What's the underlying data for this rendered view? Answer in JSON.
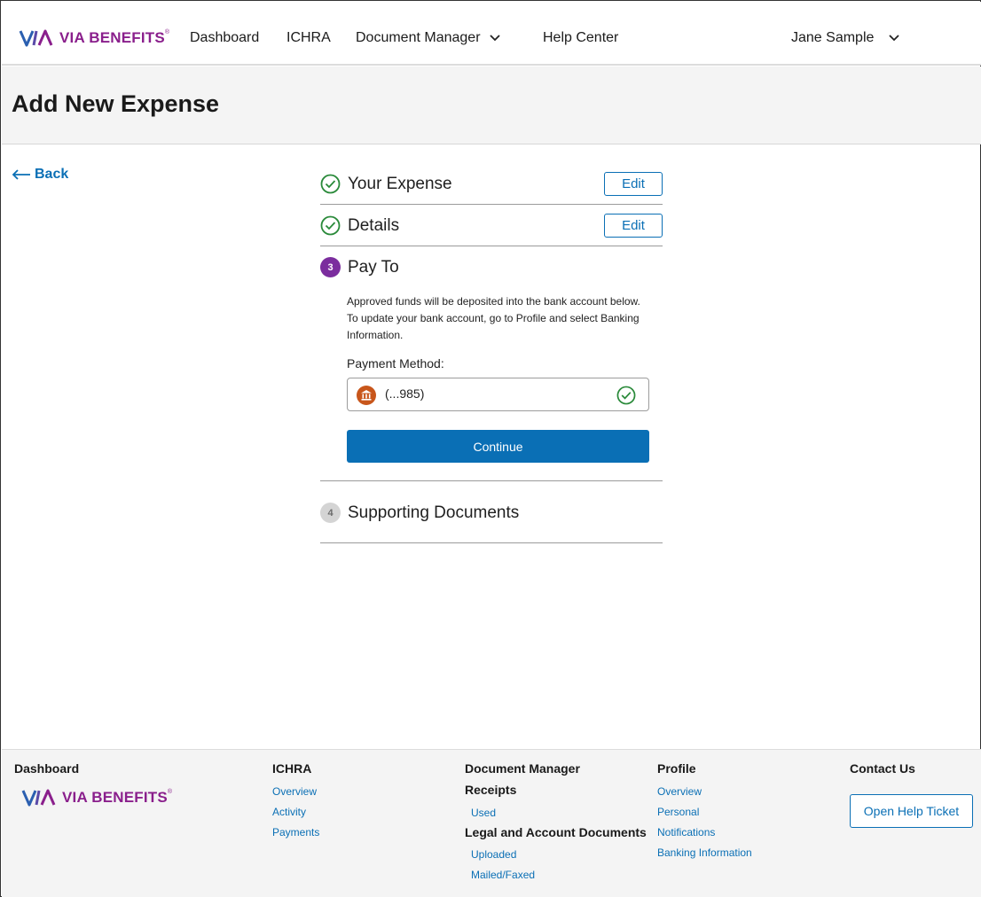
{
  "brand": {
    "name": "VIA BENEFITS",
    "reg": "®",
    "colors": {
      "purple": "#8a1f8c",
      "blue": "#0a6fb5",
      "green": "#2a8a3a",
      "orange": "#c8561b"
    }
  },
  "nav": {
    "dashboard": "Dashboard",
    "ichra": "ICHRA",
    "document_manager": "Document Manager",
    "help_center": "Help Center",
    "user_name": "Jane Sample"
  },
  "page": {
    "title": "Add New Expense",
    "back_label": "Back"
  },
  "steps": [
    {
      "label": "Your Expense",
      "status": "complete",
      "action": "Edit"
    },
    {
      "label": "Details",
      "status": "complete",
      "action": "Edit"
    },
    {
      "number": "3",
      "label": "Pay To",
      "status": "active"
    },
    {
      "number": "4",
      "label": "Supporting Documents",
      "status": "pending"
    }
  ],
  "pay_to": {
    "description": "Approved funds will be deposited into the bank account below. To update your bank account, go to Profile and select Banking Information.",
    "payment_method_label": "Payment Method:",
    "payment_method_value": "(...985)",
    "continue_label": "Continue"
  },
  "footer": {
    "dashboard": "Dashboard",
    "ichra": {
      "heading": "ICHRA",
      "links": [
        "Overview",
        "Activity",
        "Payments"
      ]
    },
    "document_manager": {
      "heading": "Document Manager",
      "receipts_heading": "Receipts",
      "receipts_links": [
        "Used"
      ],
      "legal_heading": "Legal and Account Documents",
      "legal_links": [
        "Uploaded",
        "Mailed/Faxed"
      ]
    },
    "profile": {
      "heading": "Profile",
      "links": [
        "Overview",
        "Personal",
        "Notifications",
        "Banking Information"
      ]
    },
    "contact": {
      "heading": "Contact Us",
      "button": "Open Help Ticket"
    }
  }
}
